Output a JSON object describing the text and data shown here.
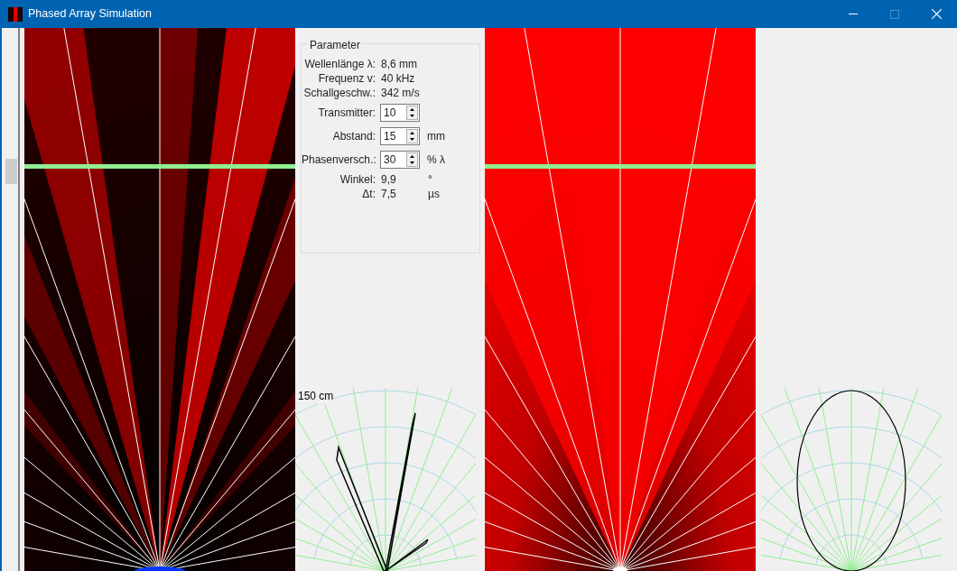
{
  "window": {
    "title": "Phased Array Simulation"
  },
  "slider": {
    "level": 0.75
  },
  "parameter_group": {
    "title": "Parameter",
    "rows": [
      {
        "kind": "readout",
        "label": "Wellenlänge λ:",
        "value": "8,6 mm"
      },
      {
        "kind": "readout",
        "label": "Frequenz v:",
        "value": "40 kHz"
      },
      {
        "kind": "readout",
        "label": "Schallgeschw.:",
        "value": "342 m/s"
      },
      {
        "kind": "spin",
        "label": "Transmitter:",
        "value": "10"
      },
      {
        "kind": "spin",
        "label": "Abstand:",
        "value": "15",
        "unit": "mm"
      },
      {
        "kind": "spin",
        "label": "Phasenversch.:",
        "value": "30",
        "unit": "% λ"
      },
      {
        "kind": "readout",
        "label": "Winkel:",
        "value": "9,9",
        "unit": "°"
      },
      {
        "kind": "readout",
        "label": "Δt:",
        "value": "7,5",
        "unit": "µs"
      }
    ]
  },
  "polar_plot": {
    "scale_label": "150 cm"
  }
}
